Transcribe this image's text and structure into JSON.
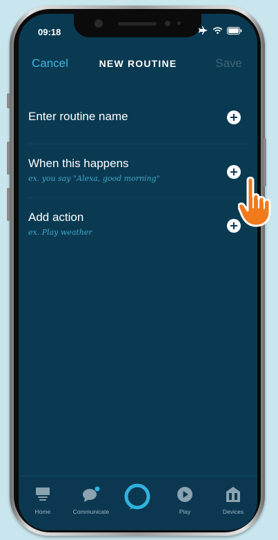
{
  "status_bar": {
    "time": "09:18",
    "icons": [
      "airplane-icon",
      "wifi-icon",
      "battery-icon"
    ]
  },
  "header": {
    "cancel_label": "Cancel",
    "title": "NEW ROUTINE",
    "save_label": "Save"
  },
  "rows": [
    {
      "label": "Enter routine name",
      "hint": "",
      "icon": "plus-circle-icon"
    },
    {
      "label": "When this happens",
      "hint": "ex. you say \"Alexa, good morning\"",
      "icon": "plus-circle-icon"
    },
    {
      "label": "Add action",
      "hint": "ex. Play weather",
      "icon": "plus-circle-icon"
    }
  ],
  "tabbar": {
    "tabs": [
      {
        "label": "Home",
        "icon": "home-icon"
      },
      {
        "label": "Communicate",
        "icon": "chat-bubble-icon"
      },
      {
        "label": "",
        "icon": "alexa-ring-icon"
      },
      {
        "label": "Play",
        "icon": "play-icon"
      },
      {
        "label": "Devices",
        "icon": "devices-house-icon"
      }
    ]
  },
  "colors": {
    "background": "#0a3a52",
    "accent": "#3fb4dc",
    "disabled": "#3d6478",
    "hint": "#3fa7c8",
    "pointer_hand": "#f07a1c"
  }
}
